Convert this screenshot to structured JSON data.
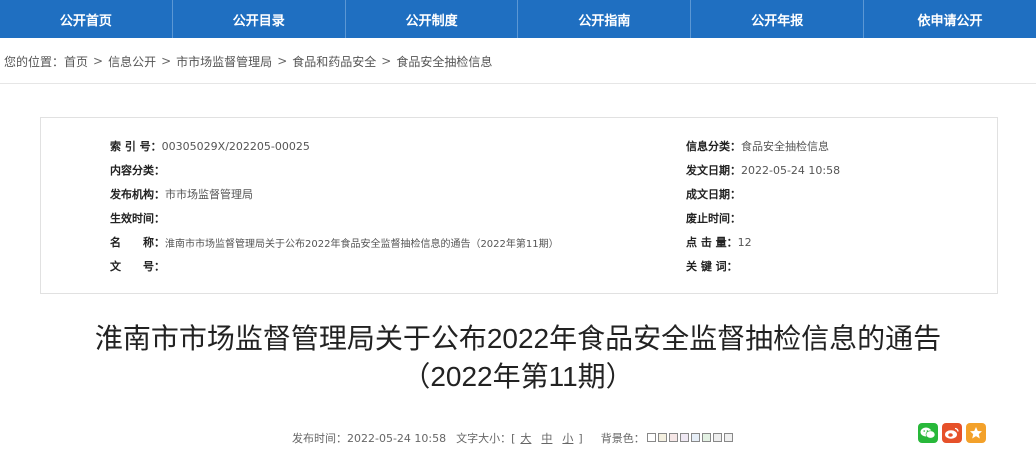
{
  "nav": {
    "items": [
      "公开首页",
      "公开目录",
      "公开制度",
      "公开指南",
      "公开年报",
      "依申请公开"
    ],
    "bg_color": "#1f6fc1"
  },
  "breadcrumb": {
    "prefix": "您的位置：",
    "items": [
      "首页",
      "信息公开",
      "市市场监督管理局",
      "食品和药品安全",
      "食品安全抽检信息"
    ],
    "separator": ">"
  },
  "meta": {
    "index_label": "索 引 号：",
    "index_value": "00305029X/202205-00025",
    "content_cat_label": "内容分类：",
    "content_cat_value": "",
    "publisher_label": "发布机构：",
    "publisher_value": "市市场监督管理局",
    "effective_label": "生效时间：",
    "effective_value": "",
    "name_label": "名　　称：",
    "name_value": "淮南市市场监督管理局关于公布2022年食品安全监督抽检信息的通告（2022年第11期）",
    "docno_label": "文　　号：",
    "docno_value": "",
    "info_cat_label": "信息分类：",
    "info_cat_value": "食品安全抽检信息",
    "issue_date_label": "发文日期：",
    "issue_date_value": "2022-05-24 10:58",
    "written_date_label": "成文日期：",
    "written_date_value": "",
    "expire_label": "废止时间：",
    "expire_value": "",
    "clicks_label": "点 击 量：",
    "clicks_value": "12",
    "keywords_label": "关 键 词：",
    "keywords_value": ""
  },
  "article": {
    "title_line1": "淮南市市场监督管理局关于公布2022年食品安全监督抽检信息的通告",
    "title_line2": "（2022年第11期）"
  },
  "info_bar": {
    "publish_time_label": "发布时间：",
    "publish_time_value": "2022-05-24 10:58",
    "font_size_label": "文字大小：[",
    "font_large": "大",
    "font_medium": "中",
    "font_small": "小",
    "font_size_close": "]",
    "bg_label": "背景色：",
    "bg_swatches": [
      "#ffffff",
      "#f4f0e0",
      "#f6e7e7",
      "#efe8f3",
      "#e6eef7",
      "#e3f1e3",
      "#eeeeee",
      "#f0f0f0"
    ]
  },
  "share": {
    "wechat_color": "#28b83a",
    "weibo_color": "#e6512a",
    "favorite_color": "#f3a12a"
  }
}
